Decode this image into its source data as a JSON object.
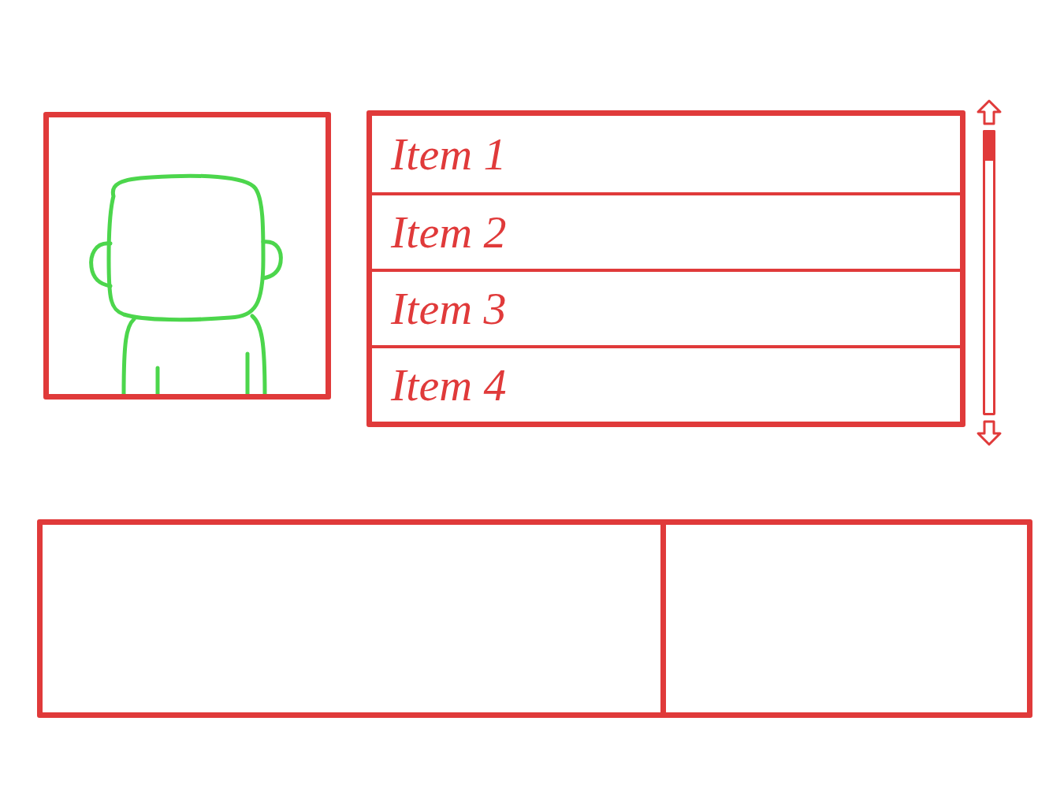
{
  "list": {
    "items": [
      {
        "label": "Item 1"
      },
      {
        "label": "Item 2"
      },
      {
        "label": "Item 3"
      },
      {
        "label": "Item 4"
      }
    ]
  },
  "scrollbar": {
    "level": 0.11
  }
}
